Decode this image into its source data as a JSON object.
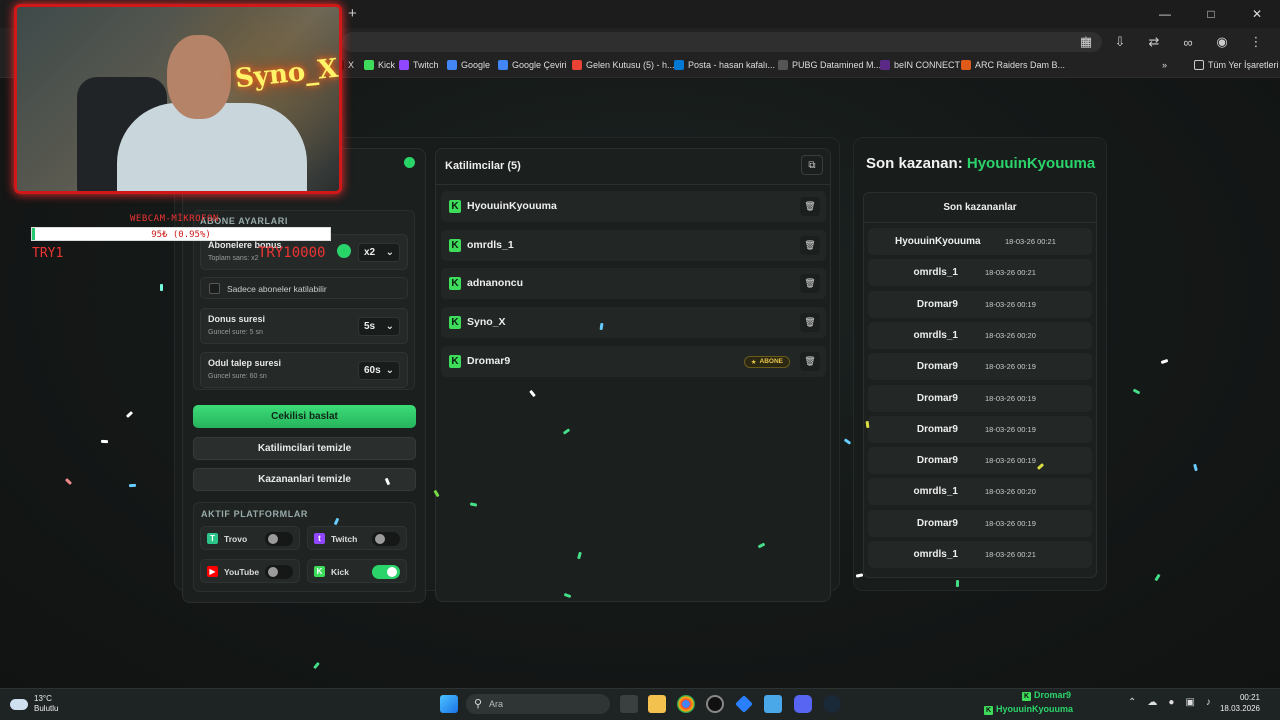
{
  "browser": {
    "new_tab": "+",
    "bookmarks": [
      {
        "label": "X",
        "color": "#000000"
      },
      {
        "label": "Kick",
        "color": "#3ddc5a"
      },
      {
        "label": "Twitch",
        "color": "#9146ff"
      },
      {
        "label": "Google",
        "color": "#4285f4"
      },
      {
        "label": "Google Çeviri",
        "color": "#4285f4"
      },
      {
        "label": "Gelen Kutusu (5) - h...",
        "color": "#ea4335"
      },
      {
        "label": "Posta - hasan kafalı...",
        "color": "#0078d4"
      },
      {
        "label": "PUBG Datamined M...",
        "color": "#555555"
      },
      {
        "label": "beIN CONNECT",
        "color": "#5b2a86"
      },
      {
        "label": "ARC Raiders Dam B...",
        "color": "#e05a1a"
      }
    ],
    "more_bookmarks": "»",
    "all_bookmarks": "Tüm Yer İşaretleri"
  },
  "overlay": {
    "webcam_sign": "Syno_X",
    "title": "WEBCAM-MİKROFON",
    "progress_text": "95₺ (0.95%)",
    "progress_percent": 0.95,
    "left_label": "TRY1",
    "right_label": "TRY10000"
  },
  "settings": {
    "section_title": "ABONE AYARLARI",
    "bonus": {
      "label": "Abonelere bonus",
      "sub": "Toplam sans: x2",
      "value": "x2"
    },
    "sub_only": "Sadece aboneler katilabilir",
    "bonus_time": {
      "label": "Donus suresi",
      "sub": "Guncel sure: 5 sn",
      "value": "5s"
    },
    "claim_time": {
      "label": "Odul talep suresi",
      "sub": "Guncel sure: 60 sn",
      "value": "60s"
    }
  },
  "actions": {
    "start": "Cekilisi baslat",
    "clear_participants": "Katilimcilari temizle",
    "clear_winners": "Kazananlari temizle"
  },
  "platforms": {
    "title": "AKTIF PLATFORMLAR",
    "items": [
      {
        "name": "Trovo",
        "enabled": false,
        "color": "#2bc58a"
      },
      {
        "name": "Twitch",
        "enabled": false,
        "color": "#9146ff"
      },
      {
        "name": "YouTube",
        "enabled": false,
        "color": "#ff0000"
      },
      {
        "name": "Kick",
        "enabled": true,
        "color": "#3ddc5a"
      }
    ]
  },
  "participants": {
    "title": "Katilimcilar (5)",
    "items": [
      {
        "name": "HyouuinKyouuma",
        "badge": ""
      },
      {
        "name": "omrdls_1",
        "badge": ""
      },
      {
        "name": "adnanoncu",
        "badge": ""
      },
      {
        "name": "Syno_X",
        "badge": ""
      },
      {
        "name": "Dromar9",
        "badge": "ABONE"
      }
    ]
  },
  "winners": {
    "title_prefix": "Son kazanan:",
    "last_winner": "HyouuinKyouuma",
    "list_title": "Son kazananlar",
    "items": [
      {
        "name": "HyouuinKyouuma",
        "date": "18-03-26 00:21"
      },
      {
        "name": "omrdls_1",
        "date": "18-03-26 00:21"
      },
      {
        "name": "Dromar9",
        "date": "18-03-26 00:19"
      },
      {
        "name": "omrdls_1",
        "date": "18-03-26 00:20"
      },
      {
        "name": "Dromar9",
        "date": "18-03-26 00:19"
      },
      {
        "name": "Dromar9",
        "date": "18-03-26 00:19"
      },
      {
        "name": "Dromar9",
        "date": "18-03-26 00:19"
      },
      {
        "name": "Dromar9",
        "date": "18-03-26 00:19"
      },
      {
        "name": "omrdls_1",
        "date": "18-03-26 00:20"
      },
      {
        "name": "Dromar9",
        "date": "18-03-26 00:19"
      },
      {
        "name": "omrdls_1",
        "date": "18-03-26 00:21"
      }
    ]
  },
  "taskbar": {
    "temperature": "13°C",
    "condition": "Bulutlu",
    "search_placeholder": "Ara",
    "stream_user1": "Dromar9",
    "stream_user2": "HyouuinKyouuma",
    "time": "00:21",
    "date": "18.03.2026"
  },
  "colors": {
    "accent": "#2bd46b",
    "overlay_red": "#d01818"
  }
}
